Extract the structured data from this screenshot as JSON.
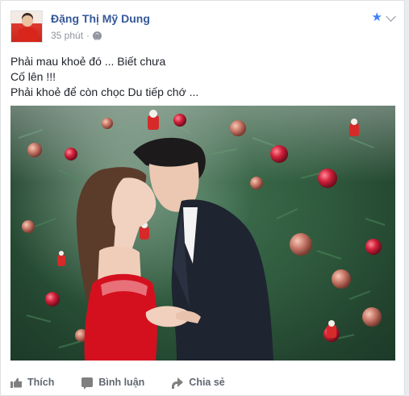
{
  "post": {
    "author": "Đặng Thị Mỹ Dung",
    "time": "35 phút",
    "separator": "·",
    "privacy_icon": "globe-icon",
    "favorite_icon": "star-icon",
    "menu_icon": "chevron-down-icon",
    "lines": [
      "Phải mau khoẻ đó ... Biết chưa",
      "Cố lên !!!",
      "Phải khoẻ để còn chọc Du tiếp chớ ..."
    ]
  },
  "actions": {
    "like": "Thích",
    "comment": "Bình luận",
    "share": "Chia sẻ"
  },
  "colors": {
    "author_link": "#365899",
    "meta_text": "#90949c",
    "star": "#4080ff",
    "action_text": "#616770"
  }
}
